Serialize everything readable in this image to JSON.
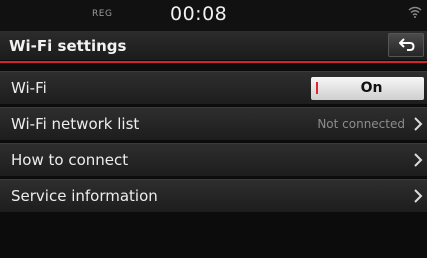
{
  "status": {
    "reg_label": "REG",
    "time": "00:08",
    "wifi_icon": "wifi-signal-icon"
  },
  "header": {
    "title": "Wi-Fi settings",
    "back_icon": "back-arrow-icon"
  },
  "accent_color": "#d2262a",
  "menu": {
    "wifi": {
      "label": "Wi-Fi",
      "toggle_value": "On"
    },
    "network_list": {
      "label": "Wi-Fi network list",
      "value": "Not connected"
    },
    "how_to_connect": {
      "label": "How to connect"
    },
    "service_info": {
      "label": "Service information"
    }
  }
}
